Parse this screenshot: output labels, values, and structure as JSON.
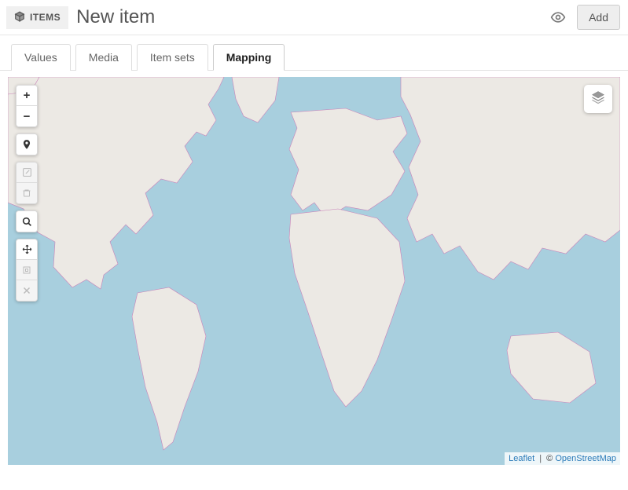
{
  "header": {
    "breadcrumb": "ITEMS",
    "title": "New item",
    "add_label": "Add"
  },
  "tabs": [
    {
      "label": "Values"
    },
    {
      "label": "Media"
    },
    {
      "label": "Item sets"
    },
    {
      "label": "Mapping",
      "active": true
    }
  ],
  "map": {
    "water_color": "#a8cfde",
    "land_fill": "#ece9e4",
    "border_color": "#c982b9",
    "zoom_in": "+",
    "zoom_out": "−",
    "attribution_leaflet": "Leaflet",
    "attribution_osm": "OpenStreetMap",
    "attribution_copy": "©"
  }
}
